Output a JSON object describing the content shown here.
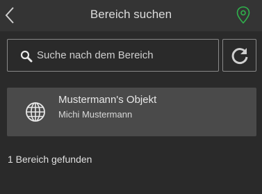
{
  "header": {
    "title": "Bereich suchen",
    "back_icon": "chevron-left-icon",
    "location_icon": "map-pin-icon"
  },
  "search": {
    "placeholder": "Suche nach dem Bereich",
    "value": "",
    "search_icon": "search-icon",
    "refresh_icon": "refresh-icon"
  },
  "results": [
    {
      "name": "Mustermann's Objekt",
      "owner": "Michi Mustermann",
      "icon": "globe-icon"
    }
  ],
  "status_text": "1 Bereich gefunden",
  "colors": {
    "background": "#2a2a2a",
    "topbar": "#343434",
    "card": "#4a4a4a",
    "accent_green": "#2fb24c"
  }
}
